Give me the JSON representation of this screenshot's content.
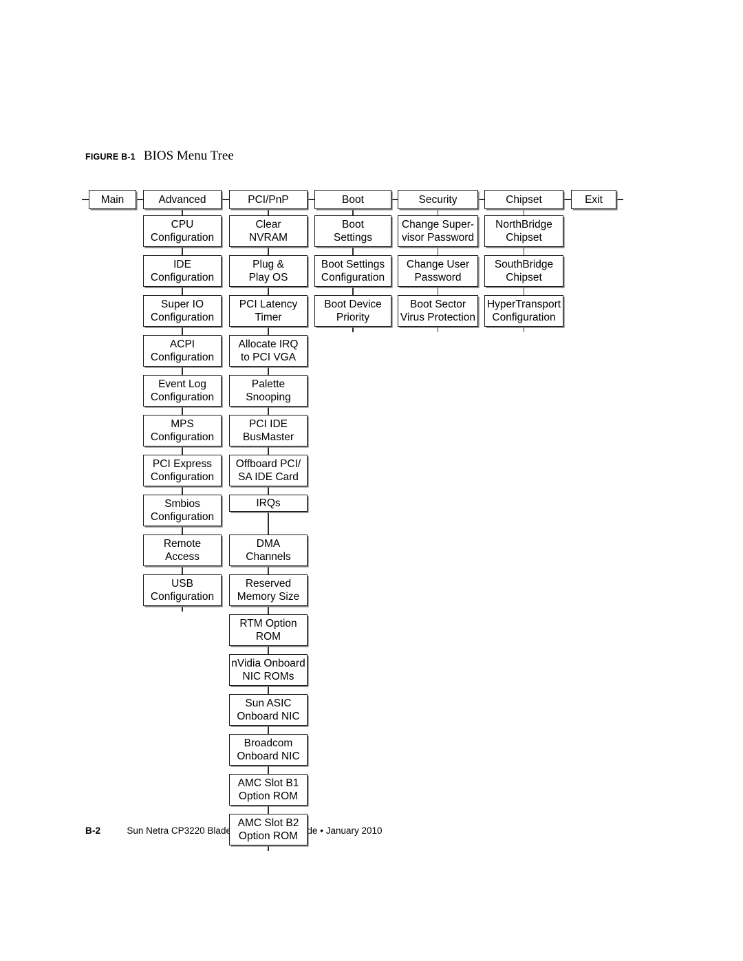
{
  "figure": {
    "label": "FIGURE B-1",
    "title": "BIOS Menu Tree"
  },
  "footer": {
    "page_number": "B-2",
    "text": "Sun Netra CP3220 Blade Server User’s Guide • January 2010"
  },
  "diagram": {
    "type": "tree",
    "orientation": "top-level menus across, submenus downward",
    "columns": [
      {
        "id": "main",
        "header": "Main",
        "children": []
      },
      {
        "id": "advanced",
        "header": "Advanced",
        "children": [
          {
            "lines": [
              "CPU",
              "Configuration"
            ]
          },
          {
            "lines": [
              "IDE",
              "Configuration"
            ]
          },
          {
            "lines": [
              "Super IO",
              "Configuration"
            ]
          },
          {
            "lines": [
              "ACPI",
              "Configuration"
            ]
          },
          {
            "lines": [
              "Event Log",
              "Configuration"
            ]
          },
          {
            "lines": [
              "MPS",
              "Configuration"
            ]
          },
          {
            "lines": [
              "PCI Express",
              "Configuration"
            ]
          },
          {
            "lines": [
              "Smbios",
              "Configuration"
            ]
          },
          {
            "lines": [
              "Remote",
              "Access"
            ]
          },
          {
            "lines": [
              "USB",
              "Configuration"
            ]
          }
        ]
      },
      {
        "id": "pcipnp",
        "header": "PCI/PnP",
        "children": [
          {
            "lines": [
              "Clear",
              "NVRAM"
            ]
          },
          {
            "lines": [
              "Plug &",
              "Play OS"
            ]
          },
          {
            "lines": [
              "PCI Latency",
              "Timer"
            ]
          },
          {
            "lines": [
              "Allocate IRQ",
              "to PCI VGA"
            ]
          },
          {
            "lines": [
              "Palette",
              "Snooping"
            ]
          },
          {
            "lines": [
              "PCI IDE",
              "BusMaster"
            ]
          },
          {
            "lines": [
              "Offboard PCI/",
              "SA IDE Card"
            ]
          },
          {
            "lines": [
              "IRQs"
            ]
          },
          {
            "lines": [
              "DMA",
              "Channels"
            ]
          },
          {
            "lines": [
              "Reserved",
              "Memory Size"
            ]
          },
          {
            "lines": [
              "RTM Option",
              "ROM"
            ]
          },
          {
            "lines": [
              "nVidia Onboard",
              "NIC ROMs"
            ]
          },
          {
            "lines": [
              "Sun ASIC",
              "Onboard NIC"
            ]
          },
          {
            "lines": [
              "Broadcom",
              "Onboard NIC"
            ]
          },
          {
            "lines": [
              "AMC Slot B1",
              "Option ROM"
            ]
          },
          {
            "lines": [
              "AMC Slot B2",
              "Option ROM"
            ]
          }
        ]
      },
      {
        "id": "boot",
        "header": "Boot",
        "children": [
          {
            "lines": [
              "Boot",
              "Settings"
            ]
          },
          {
            "lines": [
              "Boot Settings",
              "Configuration"
            ]
          },
          {
            "lines": [
              "Boot Device",
              "Priority"
            ]
          }
        ]
      },
      {
        "id": "security",
        "header": "Security",
        "children": [
          {
            "lines": [
              "Change Super-",
              "visor Password"
            ]
          },
          {
            "lines": [
              "Change User",
              "Password"
            ]
          },
          {
            "lines": [
              "Boot Sector",
              "Virus Protection"
            ]
          }
        ]
      },
      {
        "id": "chipset",
        "header": "Chipset",
        "children": [
          {
            "lines": [
              "NorthBridge",
              "Chipset"
            ]
          },
          {
            "lines": [
              "SouthBridge",
              "Chipset"
            ]
          },
          {
            "lines": [
              "HyperTransport",
              "Configuration"
            ]
          }
        ]
      },
      {
        "id": "exit",
        "header": "Exit",
        "children": []
      }
    ]
  }
}
